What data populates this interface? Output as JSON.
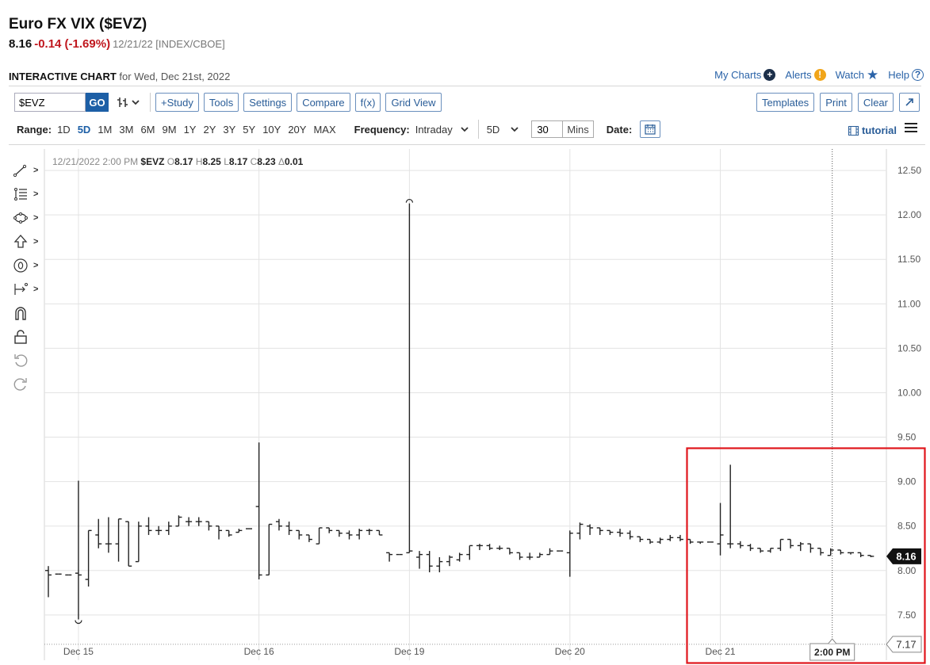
{
  "header": {
    "title": "Euro FX VIX ($EVZ)",
    "last": "8.16",
    "change": "-0.14 (-1.69%)",
    "meta": "12/21/22 [INDEX/CBOE]"
  },
  "chart_header": {
    "label": "INTERACTIVE CHART",
    "for_text": "for Wed, Dec 21st, 2022"
  },
  "top_links": {
    "my_charts": "My Charts",
    "alerts": "Alerts",
    "watch": "Watch",
    "help": "Help"
  },
  "toolbar": {
    "symbol_value": "$EVZ",
    "go": "GO",
    "study": "+Study",
    "tools": "Tools",
    "settings": "Settings",
    "compare": "Compare",
    "fx": "f(x)",
    "grid_view": "Grid View",
    "templates": "Templates",
    "print": "Print",
    "clear": "Clear"
  },
  "range_bar": {
    "range_label": "Range:",
    "ranges": [
      "1D",
      "5D",
      "1M",
      "3M",
      "6M",
      "9M",
      "1Y",
      "2Y",
      "3Y",
      "5Y",
      "10Y",
      "20Y",
      "MAX"
    ],
    "selected": "5D",
    "frequency_label": "Frequency:",
    "frequency": "Intraday",
    "period": "5D",
    "interval_value": "30",
    "interval_unit": "Mins",
    "date_label": "Date:",
    "tutorial": "tutorial"
  },
  "icons": {
    "my_charts": "plus-circle-icon",
    "alerts": "exclamation-circle-icon",
    "watch": "star-icon",
    "help": "question-circle-icon",
    "date": "calendar-icon",
    "menu": "hamburger-menu-icon"
  },
  "colors": {
    "accent": "#1d5fa6",
    "down": "#c0171e",
    "bars": "#222222",
    "highlight": "#e0151b"
  },
  "chart_data": {
    "type": "ohlc",
    "legend": {
      "datetime": "12/21/2022 2:00 PM",
      "symbol": "$EVZ",
      "open": "8.17",
      "high": "8.25",
      "low": "8.17",
      "close": "8.23",
      "change": "0.01"
    },
    "y_ticks": [
      "12.50",
      "12.00",
      "11.50",
      "11.00",
      "10.50",
      "10.00",
      "9.50",
      "9.00",
      "8.50",
      "8.00",
      "7.50"
    ],
    "ylim": [
      7.12,
      12.63
    ],
    "x_labels": [
      "Dec 15",
      "Dec 16",
      "Dec 19",
      "Dec 20",
      "Dec 21"
    ],
    "last_price_label": "8.16",
    "low_ref_label": "7.17",
    "low_ref_value": 7.17,
    "crosshair_label": "2:00 PM",
    "bars": [
      [
        8.0,
        8.05,
        7.7,
        7.95
      ],
      [
        7.96,
        7.96,
        7.96,
        7.96
      ],
      [
        7.95,
        7.95,
        7.95,
        7.95
      ],
      [
        7.97,
        9.01,
        7.45,
        7.95
      ],
      [
        7.9,
        8.45,
        7.82,
        8.45
      ],
      [
        8.4,
        8.58,
        8.25,
        8.3
      ],
      [
        8.3,
        8.6,
        8.2,
        8.3
      ],
      [
        8.3,
        8.58,
        8.1,
        8.58
      ],
      [
        8.55,
        8.55,
        8.05,
        8.05
      ],
      [
        8.1,
        8.55,
        8.1,
        8.5
      ],
      [
        8.5,
        8.6,
        8.4,
        8.45
      ],
      [
        8.45,
        8.5,
        8.4,
        8.45
      ],
      [
        8.45,
        8.55,
        8.4,
        8.5
      ],
      [
        8.5,
        8.62,
        8.5,
        8.6
      ],
      [
        8.55,
        8.6,
        8.5,
        8.55
      ],
      [
        8.55,
        8.6,
        8.5,
        8.55
      ],
      [
        8.55,
        8.55,
        8.45,
        8.5
      ],
      [
        8.5,
        8.5,
        8.35,
        8.45
      ],
      [
        8.45,
        8.45,
        8.38,
        8.4
      ],
      [
        8.43,
        8.47,
        8.43,
        8.45
      ],
      [
        8.47,
        8.47,
        8.47,
        8.47
      ],
      [
        8.72,
        9.44,
        7.9,
        7.95
      ],
      [
        7.95,
        8.52,
        7.95,
        8.52
      ],
      [
        8.55,
        8.58,
        8.45,
        8.5
      ],
      [
        8.5,
        8.55,
        8.4,
        8.45
      ],
      [
        8.45,
        8.45,
        8.35,
        8.4
      ],
      [
        8.4,
        8.4,
        8.32,
        8.35
      ],
      [
        8.3,
        8.48,
        8.3,
        8.48
      ],
      [
        8.48,
        8.48,
        8.42,
        8.45
      ],
      [
        8.45,
        8.45,
        8.38,
        8.42
      ],
      [
        8.42,
        8.45,
        8.35,
        8.4
      ],
      [
        8.4,
        8.47,
        8.35,
        8.45
      ],
      [
        8.45,
        8.47,
        8.4,
        8.45
      ],
      [
        8.45,
        8.45,
        8.4,
        8.4
      ],
      [
        8.2,
        8.2,
        8.1,
        8.18
      ],
      [
        8.18,
        8.18,
        8.18,
        8.18
      ],
      [
        8.2,
        12.13,
        8.2,
        8.22
      ],
      [
        8.15,
        8.22,
        8.02,
        8.18
      ],
      [
        8.18,
        8.22,
        7.98,
        8.05
      ],
      [
        8.05,
        8.15,
        7.98,
        8.1
      ],
      [
        8.1,
        8.17,
        8.05,
        8.15
      ],
      [
        8.12,
        8.2,
        8.1,
        8.18
      ],
      [
        8.18,
        8.28,
        8.12,
        8.28
      ],
      [
        8.28,
        8.3,
        8.23,
        8.28
      ],
      [
        8.28,
        8.3,
        8.23,
        8.25
      ],
      [
        8.25,
        8.28,
        8.23,
        8.25
      ],
      [
        8.25,
        8.25,
        8.18,
        8.2
      ],
      [
        8.2,
        8.2,
        8.12,
        8.15
      ],
      [
        8.15,
        8.2,
        8.12,
        8.15
      ],
      [
        8.15,
        8.2,
        8.15,
        8.18
      ],
      [
        8.18,
        8.25,
        8.18,
        8.22
      ],
      [
        8.22,
        8.22,
        8.22,
        8.22
      ],
      [
        8.2,
        8.45,
        7.93,
        8.42
      ],
      [
        8.42,
        8.54,
        8.35,
        8.52
      ],
      [
        8.5,
        8.52,
        8.4,
        8.48
      ],
      [
        8.48,
        8.48,
        8.4,
        8.45
      ],
      [
        8.45,
        8.45,
        8.4,
        8.43
      ],
      [
        8.43,
        8.47,
        8.38,
        8.42
      ],
      [
        8.42,
        8.45,
        8.35,
        8.38
      ],
      [
        8.38,
        8.38,
        8.32,
        8.35
      ],
      [
        8.35,
        8.35,
        8.3,
        8.32
      ],
      [
        8.32,
        8.37,
        8.3,
        8.35
      ],
      [
        8.35,
        8.4,
        8.33,
        8.37
      ],
      [
        8.37,
        8.4,
        8.33,
        8.35
      ],
      [
        8.35,
        8.35,
        8.3,
        8.32
      ],
      [
        8.32,
        8.32,
        8.3,
        8.32
      ],
      [
        8.32,
        8.32,
        8.32,
        8.32
      ],
      [
        8.3,
        8.76,
        8.17,
        8.4
      ],
      [
        8.3,
        9.19,
        8.25,
        8.3
      ],
      [
        8.3,
        8.33,
        8.25,
        8.28
      ],
      [
        8.28,
        8.3,
        8.22,
        8.25
      ],
      [
        8.25,
        8.25,
        8.2,
        8.22
      ],
      [
        8.22,
        8.25,
        8.2,
        8.25
      ],
      [
        8.25,
        8.35,
        8.22,
        8.35
      ],
      [
        8.35,
        8.35,
        8.25,
        8.28
      ],
      [
        8.28,
        8.32,
        8.22,
        8.3
      ],
      [
        8.3,
        8.3,
        8.2,
        8.25
      ],
      [
        8.25,
        8.25,
        8.17,
        8.2
      ],
      [
        8.17,
        8.25,
        8.17,
        8.23
      ],
      [
        8.23,
        8.23,
        8.18,
        8.2
      ],
      [
        8.2,
        8.2,
        8.18,
        8.2
      ],
      [
        8.2,
        8.2,
        8.15,
        8.17
      ],
      [
        8.17,
        8.17,
        8.15,
        8.16
      ]
    ],
    "crosshair_bar_index": 78,
    "day_start_indices": [
      3,
      21,
      36,
      52,
      67
    ]
  }
}
